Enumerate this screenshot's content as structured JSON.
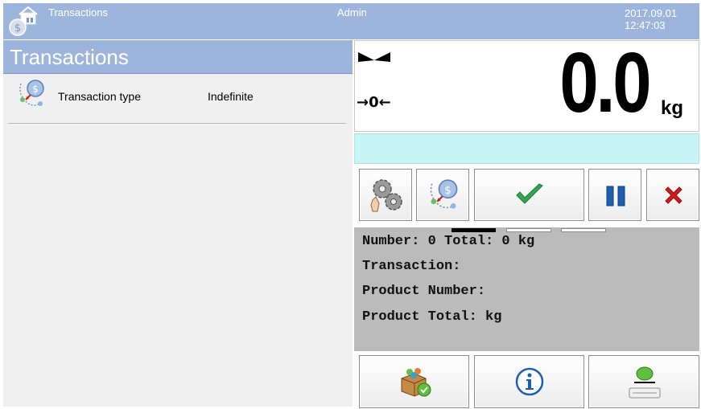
{
  "topbar": {
    "title": "Transactions",
    "user": "Admin",
    "date": "2017.09.01",
    "time": "12:47:03",
    "app_icon": "transactions-app-icon"
  },
  "left_panel": {
    "header": "Transactions",
    "rows": [
      {
        "label": "Transaction type",
        "value": "Indefinite",
        "icon": "transaction-type-icon"
      }
    ]
  },
  "display": {
    "weight": "0.0",
    "unit": "kg",
    "zero_indicator": "→0←",
    "stable_icon": "stable-indicator-icon"
  },
  "buttons": {
    "top": [
      {
        "icon": "settings-gears-icon"
      },
      {
        "icon": "transaction-type-icon"
      },
      {
        "icon": "checkmark-icon"
      },
      {
        "icon": "pause-icon"
      },
      {
        "icon": "close-x-icon"
      }
    ],
    "bottom": [
      {
        "icon": "product-box-check-icon"
      },
      {
        "icon": "info-icon"
      },
      {
        "icon": "tare-icon"
      }
    ]
  },
  "info": {
    "lines": [
      "Number: 0 Total: 0 kg",
      "Transaction:",
      "Product Number:",
      "Product Total: kg"
    ],
    "pages": {
      "count": 3,
      "active": 1
    }
  },
  "colors": {
    "header_blue": "#9db5dc",
    "panel_gray": "#f0f0f0",
    "cyan_bar": "#c7f5f6",
    "info_gray": "#bbbbbb",
    "check_green": "#2fa84f",
    "pause_blue": "#1f5fb0",
    "close_red": "#d11a1a"
  }
}
